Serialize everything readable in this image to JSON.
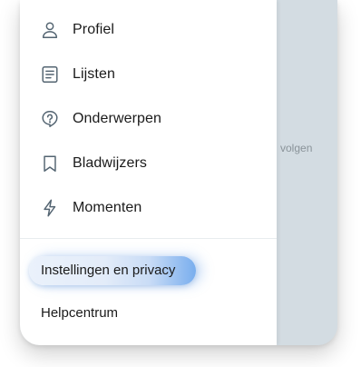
{
  "menu": {
    "items": [
      {
        "label": "Profiel",
        "icon": "user-icon"
      },
      {
        "label": "Lijsten",
        "icon": "list-icon"
      },
      {
        "label": "Onderwerpen",
        "icon": "topic-icon"
      },
      {
        "label": "Bladwijzers",
        "icon": "bookmark-icon"
      },
      {
        "label": "Momenten",
        "icon": "lightning-icon"
      }
    ]
  },
  "settings": {
    "label": "Instellingen en privacy"
  },
  "help": {
    "label": "Helpcentrum"
  },
  "background": {
    "partial_text": "volgen"
  },
  "colors": {
    "highlight": "#79aeee",
    "text": "#1a1a1a",
    "icon": "#536471",
    "backdrop": "#d3dce2"
  }
}
